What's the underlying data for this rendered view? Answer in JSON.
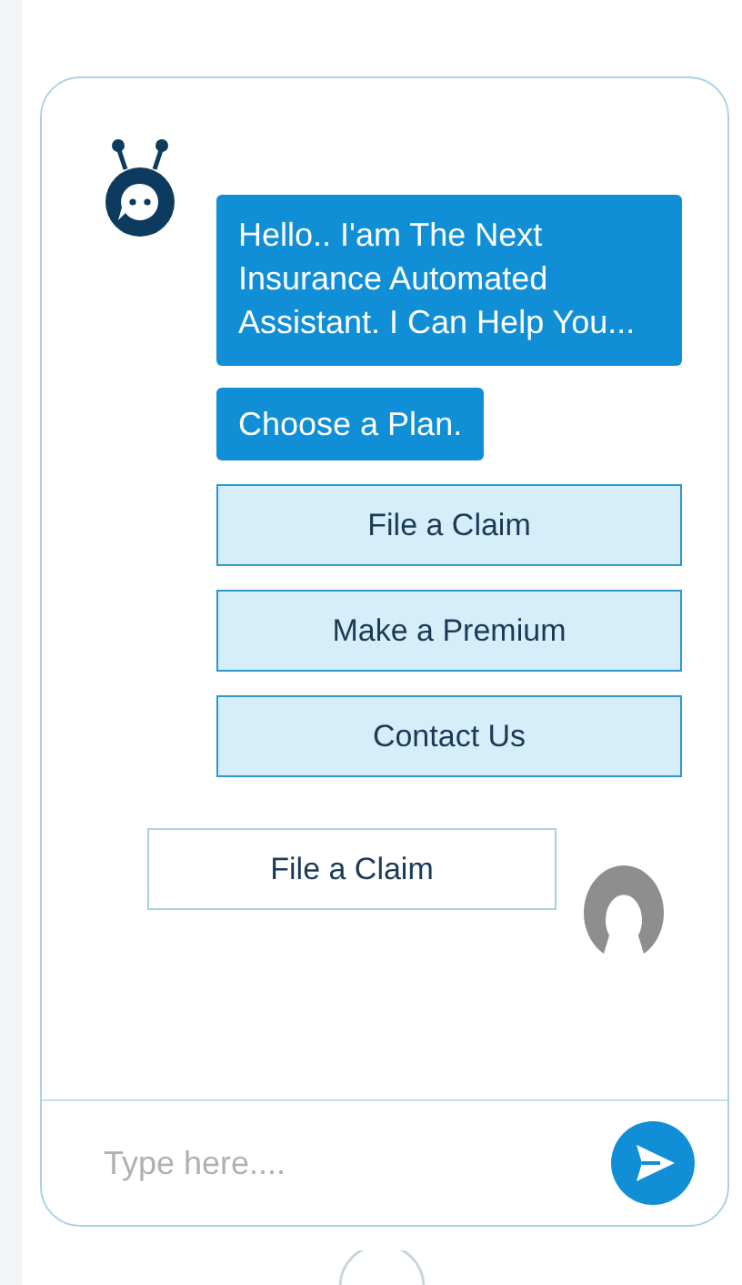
{
  "bot_messages": [
    {
      "text": "Hello.. I'am The Next Insurance Automated Assistant. I Can Help You..."
    },
    {
      "text": "Choose a Plan."
    }
  ],
  "options": [
    {
      "label": "File a Claim"
    },
    {
      "label": "Make a Premium"
    },
    {
      "label": "Contact Us"
    }
  ],
  "user_messages": [
    {
      "text": "File a Claim"
    }
  ],
  "composer": {
    "placeholder": "Type here...."
  }
}
